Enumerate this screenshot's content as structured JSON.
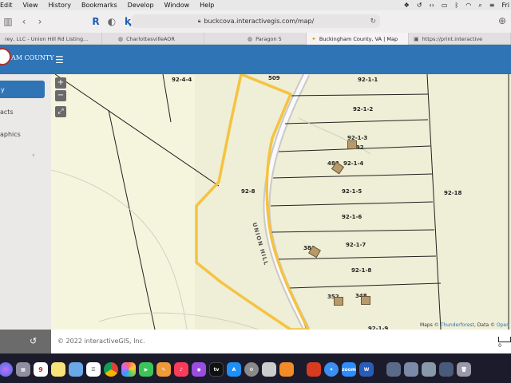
{
  "menubar": {
    "items": [
      "Edit",
      "View",
      "History",
      "Bookmarks",
      "Develop",
      "Window",
      "Help"
    ],
    "right_time": "Fri"
  },
  "toolbar": {
    "url": "buckcova.interactivegis.com/map/"
  },
  "tabs": [
    {
      "label": "rey, LLC - Union Hill Rd Listing...",
      "active": false
    },
    {
      "label": "CharlottesvilleAOR",
      "active": false
    },
    {
      "label": "Paragon 5",
      "active": false
    },
    {
      "label": "Buckingham County, VA | Map",
      "active": true
    },
    {
      "label": "https://print.interactive",
      "active": false
    }
  ],
  "header": {
    "logo_text": "AM COUNTY"
  },
  "sidebar": {
    "active_label": "y",
    "items": [
      "acts",
      "aphics"
    ]
  },
  "map": {
    "road_label": "UNION HILL",
    "parcels": [
      {
        "id": "92-4-4"
      },
      {
        "id": "509"
      },
      {
        "id": "92-1-1"
      },
      {
        "id": "92-1-2"
      },
      {
        "id": "92-1-3"
      },
      {
        "id": "492"
      },
      {
        "id": "488"
      },
      {
        "id": "92-1-4"
      },
      {
        "id": "92-8"
      },
      {
        "id": "92-1-5"
      },
      {
        "id": "92-18"
      },
      {
        "id": "92-1-6"
      },
      {
        "id": "384"
      },
      {
        "id": "92-1-7"
      },
      {
        "id": "92-1-8"
      },
      {
        "id": "352"
      },
      {
        "id": "348"
      },
      {
        "id": "92-1-9"
      }
    ],
    "attribution_prefix": "Maps ©",
    "attribution_link1": "Thunderforest",
    "attribution_mid": ", Data ©",
    "attribution_link2": "Open"
  },
  "footer": {
    "copyright": "© 2022 interactiveGIS, Inc.",
    "scale_label": "0"
  },
  "dock": {
    "calendar_day": "9",
    "apps": [
      "siri",
      "launchpad",
      "calendar",
      "notes",
      "preview",
      "reminders",
      "chrome",
      "photos",
      "facetime",
      "pages",
      "music",
      "podcasts",
      "tv",
      "appstore",
      "settings",
      "preview2",
      "books",
      "office",
      "safari",
      "zoom",
      "word",
      "finder-win",
      "window2",
      "window3",
      "trash"
    ]
  },
  "colors": {
    "header": "#2f74b5",
    "highlight": "#f5c342",
    "map_bg": "#f5f4dd"
  }
}
